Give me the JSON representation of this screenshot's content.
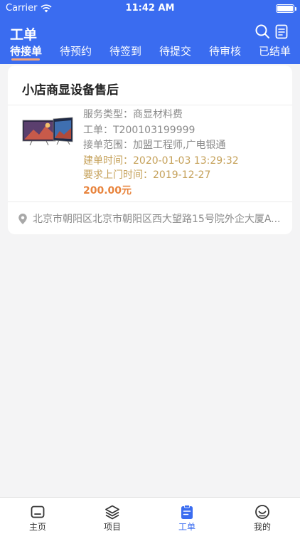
{
  "status_bar": {
    "carrier": "Carrier",
    "time": "11:42 AM"
  },
  "header": {
    "title": "工单",
    "search_icon": "search-icon",
    "list_icon": "clipboard-list-icon"
  },
  "tabs": [
    {
      "label": "待接单",
      "active": true
    },
    {
      "label": "待预约"
    },
    {
      "label": "待签到"
    },
    {
      "label": "待提交"
    },
    {
      "label": "待审核"
    },
    {
      "label": "已结单"
    }
  ],
  "order": {
    "title": "小店商显设备售后",
    "service_type": "服务类型：商显材料费",
    "order_no": "工单：T200103199999",
    "scope": "接单范围：加盟工程师,广电银通",
    "created": "建单时间：2020-01-03 13:29:32",
    "visit": "要求上门时间：2019-12-27",
    "price": "200.00元",
    "address": "北京市朝阳区北京市朝阳区西大望路15号院外企大厦A..."
  },
  "tabbar": [
    {
      "label": "主页",
      "icon": "home-icon"
    },
    {
      "label": "项目",
      "icon": "layers-icon"
    },
    {
      "label": "工单",
      "icon": "clipboard-icon",
      "active": true
    },
    {
      "label": "我的",
      "icon": "smile-icon"
    }
  ],
  "colors": {
    "primary": "#3a6cf0",
    "accent": "#e8843d",
    "gold": "#c5a15a",
    "underline": "#f3a57a"
  }
}
